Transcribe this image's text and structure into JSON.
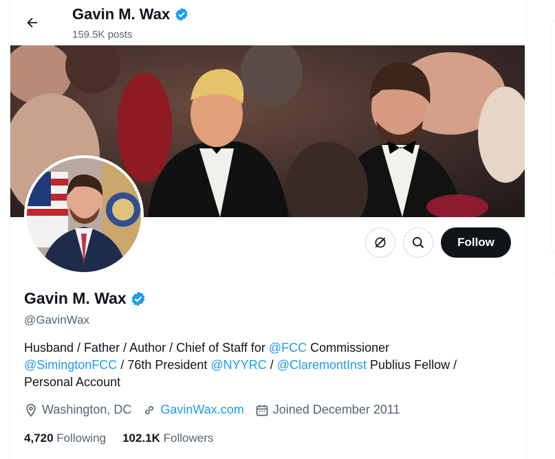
{
  "header": {
    "name": "Gavin M. Wax",
    "posts": "159.5K posts"
  },
  "profile": {
    "name": "Gavin M. Wax",
    "handle": "@GavinWax",
    "bio": {
      "line1_a": "Husband / Father / Author / Chief of Staff for ",
      "mention_fcc": "@FCC",
      "line1_b": " Commissioner",
      "mention_simington": "@SimingtonFCC",
      "line2_a": " / 76th President ",
      "mention_nyyrc": "@NYYRC",
      "line2_b": " / ",
      "mention_claremont": "@ClaremontInst",
      "line2_c": " Publius Fellow /",
      "line3": "Personal Account"
    },
    "location": "Washington, DC",
    "website": "GavinWax.com",
    "joined": "Joined December 2011"
  },
  "stats": {
    "following_count": "4,720",
    "following_label": "Following",
    "followers_count": "102.1K",
    "followers_label": "Followers"
  },
  "actions": {
    "follow_label": "Follow"
  },
  "icons": {
    "back": "arrow-left-icon",
    "verified": "verified-badge-icon",
    "grok": "grok-icon",
    "search": "search-icon",
    "location": "location-pin-icon",
    "link": "link-icon",
    "calendar": "calendar-icon"
  },
  "colors": {
    "accent": "#1d9bf0",
    "text": "#0f1419",
    "secondary": "#536471",
    "follow_bg": "#0f1419"
  }
}
